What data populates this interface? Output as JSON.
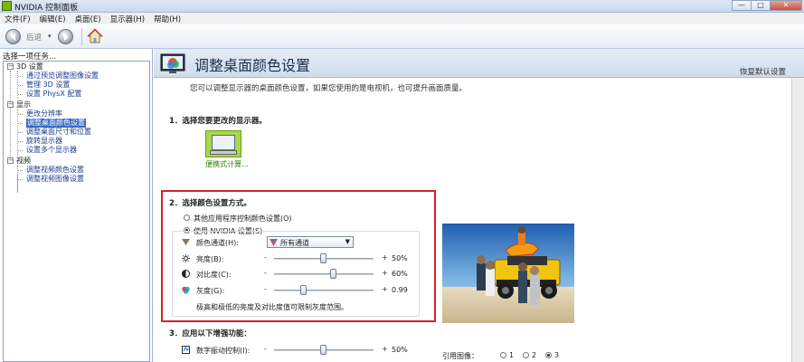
{
  "window": {
    "title": "NVIDIA 控制面板",
    "buttons": {
      "minimize": "—",
      "maximize": "□",
      "close": "✕"
    }
  },
  "menu": [
    "文件(F)",
    "编辑(E)",
    "桌面(E)",
    "显示器(H)",
    "帮助(H)"
  ],
  "toolbar": {
    "back_label": "后退",
    "dropdown": "▾"
  },
  "sidebar": {
    "caption": "选择一项任务...",
    "tree": [
      {
        "label": "3D 设置",
        "type": "category"
      },
      {
        "label": "通过预览调整图像设置",
        "type": "leaf"
      },
      {
        "label": "管理 3D 设置",
        "type": "leaf"
      },
      {
        "label": "设置 PhysX 配置",
        "type": "leaf"
      },
      {
        "label": "显示",
        "type": "category"
      },
      {
        "label": "更改分辨率",
        "type": "leaf"
      },
      {
        "label": "调整桌面颜色设置",
        "type": "leaf",
        "selected": true
      },
      {
        "label": "调整桌面尺寸和位置",
        "type": "leaf"
      },
      {
        "label": "旋转显示器",
        "type": "leaf"
      },
      {
        "label": "设置多个显示器",
        "type": "leaf"
      },
      {
        "label": "视频",
        "type": "category"
      },
      {
        "label": "调整视频颜色设置",
        "type": "leaf"
      },
      {
        "label": "调整视频图像设置",
        "type": "leaf"
      }
    ]
  },
  "main": {
    "title": "调整桌面颜色设置",
    "restore_defaults": "恢复默认设置",
    "description": "您可以调整显示器的桌面颜色设置，如果您使用的是电视机，也可提升画面质量。",
    "section1": {
      "title": "1．选择您要更改的显示器。",
      "display_label": "便携式计算..."
    },
    "section2": {
      "title": "2．选择颜色设置方式。",
      "option_other": "其他应用程序控制颜色设置(O)",
      "option_nvidia": "使用 NVIDIA 设置(S)",
      "channel_label": "颜色通道(H):",
      "channel_value": "所有通道",
      "brightness": {
        "label": "亮度(B):",
        "minus": "-",
        "plus": "+",
        "value": "50%",
        "level": 0.5
      },
      "contrast": {
        "label": "对比度(C):",
        "minus": "-",
        "plus": "+",
        "value": "60%",
        "level": 0.6
      },
      "gamma": {
        "label": "灰度(G):",
        "minus": "-",
        "plus": "+",
        "value": "0.99",
        "level": 0.3
      },
      "note": "极高和极低的亮度及对比度值可限制灰度范围。"
    },
    "section3": {
      "title": "3．应用以下增强功能：",
      "vibrance": {
        "label": "数字振动控制(I):",
        "minus": "-",
        "plus": "+",
        "value": "50%",
        "level": 0.5
      },
      "reference_label": "引用图像：",
      "reference_options": [
        "1",
        "2",
        "3"
      ],
      "reference_selected": 2
    }
  }
}
